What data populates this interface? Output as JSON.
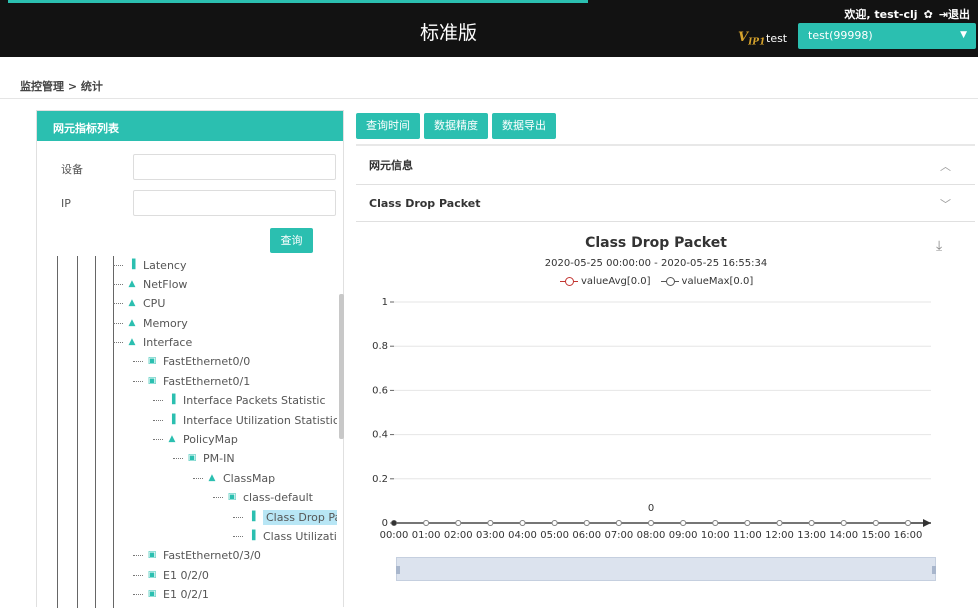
{
  "header": {
    "app_title": "标准版",
    "welcome": "欢迎, test-clj",
    "logout": "退出",
    "vip_mark": "V",
    "vip_sub": "IP1",
    "vip_user": "test",
    "tenant_selected": "test(99998)"
  },
  "breadcrumb": "监控管理 > 统计",
  "left_panel": {
    "title": "网元指标列表",
    "device_label": "设备",
    "ip_label": "IP",
    "device_value": "",
    "ip_value": "",
    "query_label": "查询"
  },
  "tree": [
    {
      "label": "Latency",
      "icon": "bar-icon"
    },
    {
      "label": "NetFlow",
      "icon": "house-icon"
    },
    {
      "label": "CPU",
      "icon": "house-icon"
    },
    {
      "label": "Memory",
      "icon": "house-icon"
    },
    {
      "label": "Interface",
      "icon": "house-icon"
    },
    {
      "label": "FastEthernet0/0",
      "icon": "folder-icon"
    },
    {
      "label": "FastEthernet0/1",
      "icon": "folder-icon"
    },
    {
      "label": "Interface Packets Statistic",
      "icon": "bar-icon"
    },
    {
      "label": "Interface Utilization Statistic",
      "icon": "bar-icon"
    },
    {
      "label": "PolicyMap",
      "icon": "house-icon"
    },
    {
      "label": "PM-IN",
      "icon": "folder-icon"
    },
    {
      "label": "ClassMap",
      "icon": "house-icon"
    },
    {
      "label": "class-default",
      "icon": "folder-icon"
    },
    {
      "label": "Class Drop Pack",
      "icon": "bar-icon"
    },
    {
      "label": "Class Utilization",
      "icon": "bar-icon"
    },
    {
      "label": "FastEthernet0/3/0",
      "icon": "folder-icon"
    },
    {
      "label": "E1 0/2/0",
      "icon": "folder-icon"
    },
    {
      "label": "E1 0/2/1",
      "icon": "folder-icon"
    }
  ],
  "toolbar": {
    "query_time": "查询时间",
    "data_precision": "数据精度",
    "data_export": "数据导出"
  },
  "sections": {
    "ne_info": "网元信息",
    "class_drop": "Class Drop Packet"
  },
  "colors": {
    "accent": "#2bbfb0",
    "header_bg": "#121212",
    "series_avg": "#c23531",
    "series_max": "#555555"
  },
  "chart_data": {
    "type": "line",
    "title": "Class Drop Packet",
    "subtitle": "2020-05-25 00:00:00 - 2020-05-25 16:55:34",
    "categories": [
      "00:00",
      "01:00",
      "02:00",
      "03:00",
      "04:00",
      "05:00",
      "06:00",
      "07:00",
      "08:00",
      "09:00",
      "10:00",
      "11:00",
      "12:00",
      "13:00",
      "14:00",
      "15:00",
      "16:00"
    ],
    "series": [
      {
        "name": "valueAvg[0.0]",
        "values": [
          0,
          0,
          0,
          0,
          0,
          0,
          0,
          0,
          0,
          0,
          0,
          0,
          0,
          0,
          0,
          0,
          0
        ]
      },
      {
        "name": "valueMax[0.0]",
        "values": [
          0,
          0,
          0,
          0,
          0,
          0,
          0,
          0,
          0,
          0,
          0,
          0,
          0,
          0,
          0,
          0,
          0
        ]
      }
    ],
    "data_label": {
      "category": "08:00",
      "text": "0"
    },
    "y_ticks": [
      "0",
      "0.2",
      "0.4",
      "0.6",
      "0.8",
      "1"
    ],
    "ylim": [
      0,
      1
    ],
    "grid": true,
    "legend_position": "top"
  }
}
